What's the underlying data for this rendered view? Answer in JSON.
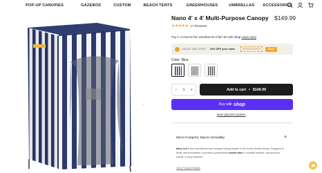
{
  "nav": {
    "links": [
      "POP-UP CANOPIES",
      "GAZEBOS",
      "CUSTOM",
      "BEACH TENTS",
      "GREENHOUSES",
      "UMBRELLAS",
      "ACCESSORIES"
    ],
    "icons": [
      "search-icon",
      "user-icon",
      "cart-icon"
    ]
  },
  "product": {
    "title": "Nano 4' x 4' Multi-Purpose Canopy",
    "price": "$149.99",
    "stars": "★★★★★",
    "reviews": "17 Reviews",
    "installments_prefix": "Pay in 4 interest-free installments of $37.50 with",
    "installments_brand": "shop",
    "installments_link": "Learn more",
    "promo": {
      "label": "LIMITED TIME OFFER",
      "save": "10% OFF your order",
      "code": "SPRINGSAVE10",
      "button": "Copy"
    },
    "color_label": "Color: Blue",
    "quantity": "1",
    "qty_minus": "−",
    "qty_plus": "+",
    "add_to_cart": "Add to cart",
    "add_to_cart_sep": "•",
    "add_to_cart_price": "$149.99",
    "shoppay_text": "Buy with",
    "shoppay_brand": "shop",
    "more_payment": "More payment options"
  },
  "description": {
    "heading": "Micro Footprint. Macro Versatility.",
    "close": "×",
    "body_brand": "Nano 4×4",
    "body": "is the most efficient and compact canopy shelter in the Crown Shades lineup. Designed to break new boundaries, it provides a professional",
    "body_bold": "mobile base",
    "body_tail": "in crowded markets, narrow photo shoots, or busy beaches.",
    "link": "View Product Details"
  },
  "gallery": {
    "next": "›"
  },
  "colors": {
    "shoppay": "#5a31f4",
    "cart": "#1c1c1c",
    "promo": "#f0a727",
    "stripe": "#2b3a6b"
  }
}
